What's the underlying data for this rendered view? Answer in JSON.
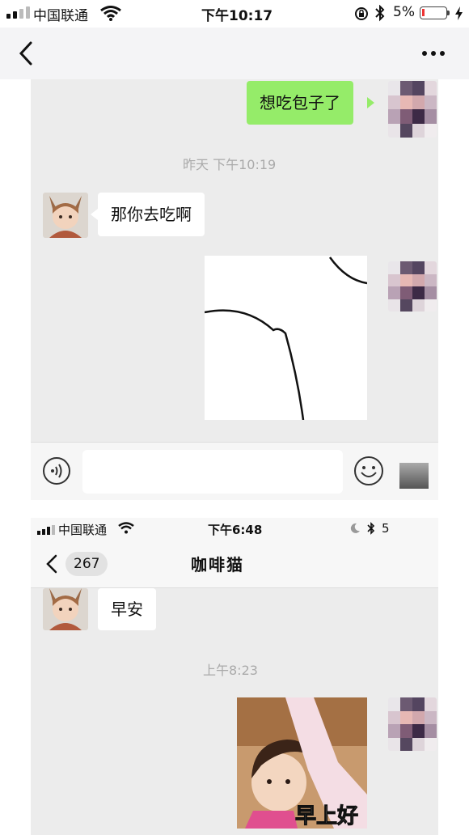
{
  "status_bar": {
    "carrier": "中国联通",
    "time": "下午10:17",
    "battery": "5%"
  },
  "chat1": {
    "msg_sent_1": "想吃包子了",
    "timestamp": "昨天 下午10:19",
    "msg_recv_1": "那你去吃啊"
  },
  "status_bar_2": {
    "carrier": "中国联通",
    "time": "下午6:48",
    "battery": "5"
  },
  "nav2": {
    "back_count": "267",
    "title": "咖啡猫"
  },
  "chat2": {
    "msg_recv_1": "早安",
    "timestamp": "上午8:23",
    "sticker_caption": "早上好"
  }
}
